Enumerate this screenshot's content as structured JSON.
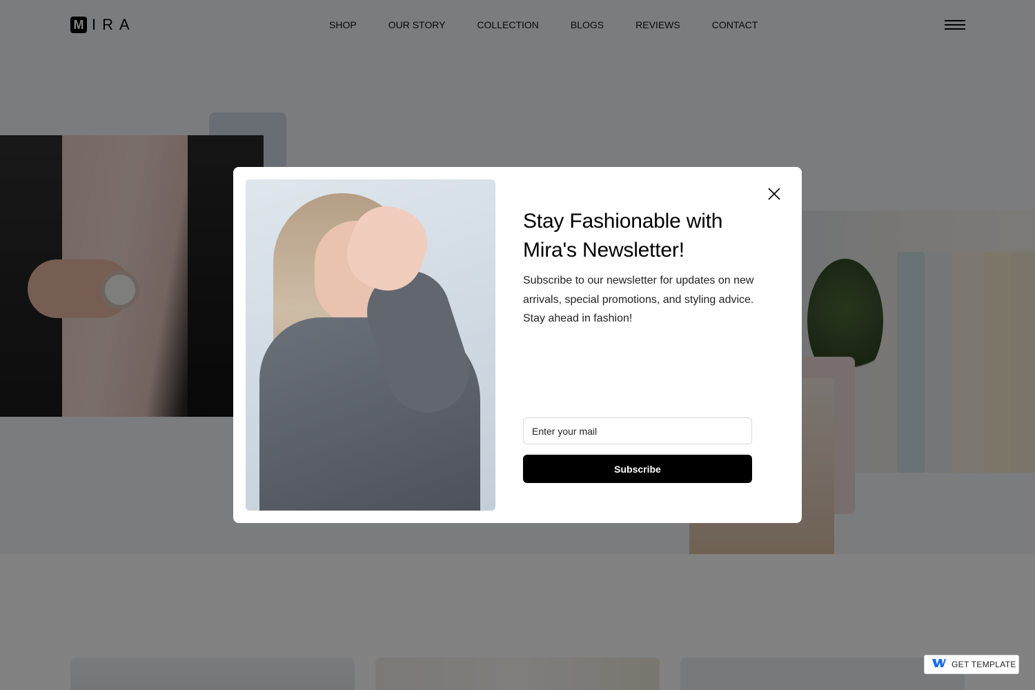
{
  "brand": {
    "logo_letter": "M",
    "logo_rest": "IRA"
  },
  "nav": {
    "items": [
      {
        "label": "SHOP"
      },
      {
        "label": "OUR STORY"
      },
      {
        "label": "COLLECTION"
      },
      {
        "label": "BLOGS"
      },
      {
        "label": "REVIEWS"
      },
      {
        "label": "CONTACT"
      }
    ],
    "menu_icon": "hamburger-icon"
  },
  "modal": {
    "title": "Stay Fashionable with Mira's Newsletter!",
    "body": "Subscribe to our newsletter for updates on new arrivals, special promotions, and styling advice. Stay ahead in fashion!",
    "email_placeholder": "Enter your mail",
    "email_value": "",
    "subscribe_label": "Subscribe",
    "close_icon": "close-icon"
  },
  "badge": {
    "label": "GET TEMPLATE",
    "icon": "webflow-icon",
    "icon_color": "#146ef5"
  },
  "colors": {
    "overlay": "rgba(0,0,0,0.49)",
    "button_bg": "#000000",
    "hero_bg": "#f2f3f6"
  }
}
